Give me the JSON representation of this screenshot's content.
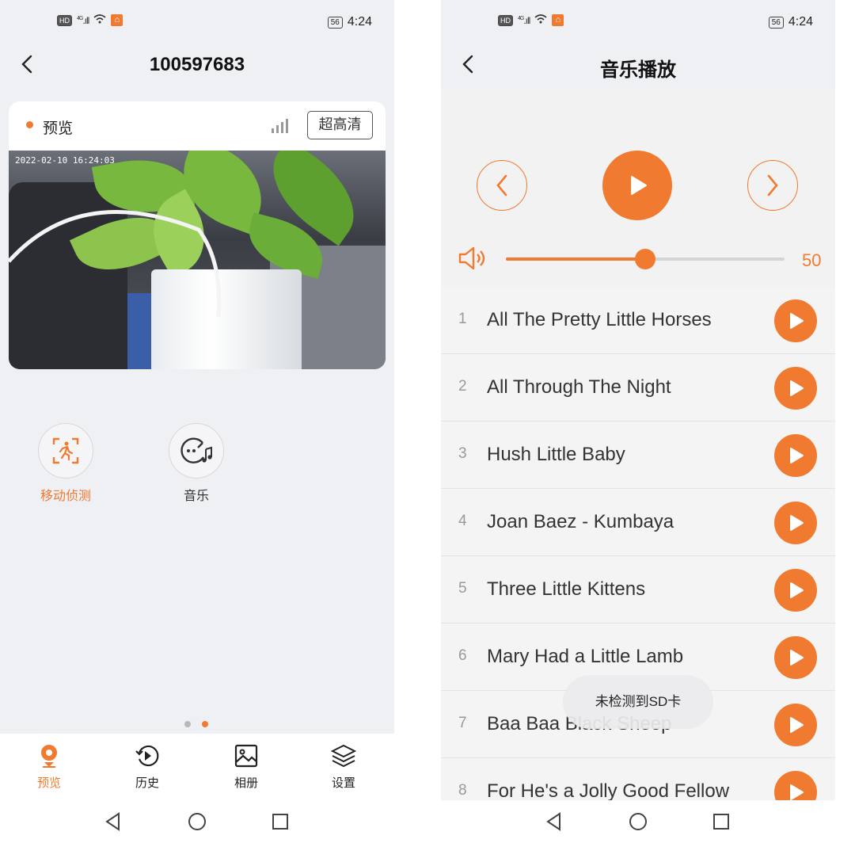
{
  "status": {
    "network": "4G",
    "battery": "56",
    "time": "4:24"
  },
  "left": {
    "title": "100597683",
    "card": {
      "label": "预览",
      "quality_button": "超高清",
      "timestamp": "2022-02-10 16:24:03"
    },
    "features": [
      {
        "label": "移动侦测",
        "icon": "motion-detect-icon",
        "active": true
      },
      {
        "label": "音乐",
        "icon": "music-icon",
        "active": false
      }
    ],
    "page_dots": {
      "count": 2,
      "active": 2
    },
    "tabs": [
      {
        "label": "预览",
        "icon": "camera-pin-icon",
        "active": true
      },
      {
        "label": "历史",
        "icon": "history-icon",
        "active": false
      },
      {
        "label": "相册",
        "icon": "album-icon",
        "active": false
      },
      {
        "label": "设置",
        "icon": "layers-icon",
        "active": false
      }
    ]
  },
  "right": {
    "title": "音乐播放",
    "volume": 50,
    "volume_label": "50",
    "songs": [
      {
        "num": "1",
        "name": "All The Pretty Little Horses"
      },
      {
        "num": "2",
        "name": "All Through The Night"
      },
      {
        "num": "3",
        "name": "Hush Little Baby"
      },
      {
        "num": "4",
        "name": "Joan Baez - Kumbaya"
      },
      {
        "num": "5",
        "name": "Three Little Kittens"
      },
      {
        "num": "6",
        "name": "Mary Had a Little Lamb"
      },
      {
        "num": "7",
        "name": "Baa Baa Black Sheep"
      },
      {
        "num": "8",
        "name": "For He's a Jolly Good Fellow"
      }
    ],
    "toast": "未检测到SD卡"
  },
  "colors": {
    "accent": "#f07a30",
    "background": "#eff0f4"
  }
}
